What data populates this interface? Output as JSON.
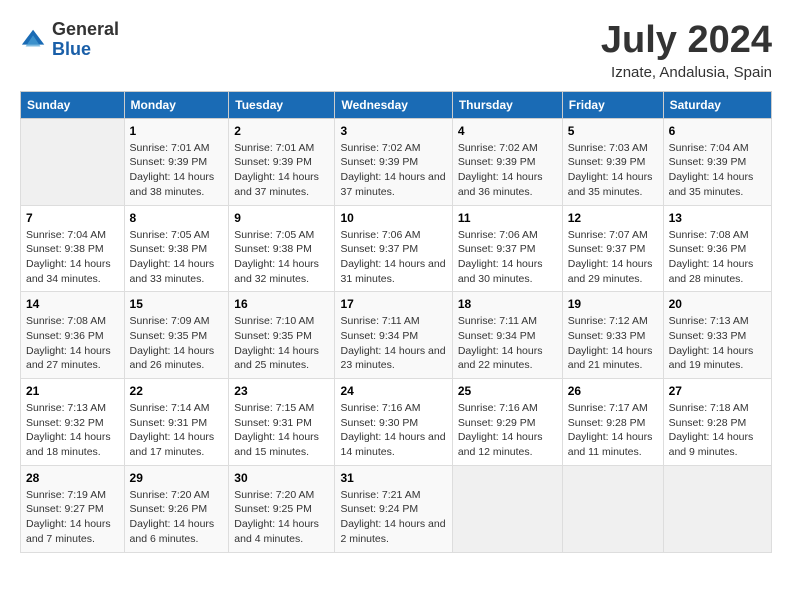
{
  "header": {
    "logo_line1": "General",
    "logo_line2": "Blue",
    "main_title": "July 2024",
    "subtitle": "Iznate, Andalusia, Spain"
  },
  "calendar": {
    "days_of_week": [
      "Sunday",
      "Monday",
      "Tuesday",
      "Wednesday",
      "Thursday",
      "Friday",
      "Saturday"
    ],
    "weeks": [
      [
        {
          "day": "",
          "sunrise": "",
          "sunset": "",
          "daylight": ""
        },
        {
          "day": "1",
          "sunrise": "Sunrise: 7:01 AM",
          "sunset": "Sunset: 9:39 PM",
          "daylight": "Daylight: 14 hours and 38 minutes."
        },
        {
          "day": "2",
          "sunrise": "Sunrise: 7:01 AM",
          "sunset": "Sunset: 9:39 PM",
          "daylight": "Daylight: 14 hours and 37 minutes."
        },
        {
          "day": "3",
          "sunrise": "Sunrise: 7:02 AM",
          "sunset": "Sunset: 9:39 PM",
          "daylight": "Daylight: 14 hours and 37 minutes."
        },
        {
          "day": "4",
          "sunrise": "Sunrise: 7:02 AM",
          "sunset": "Sunset: 9:39 PM",
          "daylight": "Daylight: 14 hours and 36 minutes."
        },
        {
          "day": "5",
          "sunrise": "Sunrise: 7:03 AM",
          "sunset": "Sunset: 9:39 PM",
          "daylight": "Daylight: 14 hours and 35 minutes."
        },
        {
          "day": "6",
          "sunrise": "Sunrise: 7:04 AM",
          "sunset": "Sunset: 9:39 PM",
          "daylight": "Daylight: 14 hours and 35 minutes."
        }
      ],
      [
        {
          "day": "7",
          "sunrise": "Sunrise: 7:04 AM",
          "sunset": "Sunset: 9:38 PM",
          "daylight": "Daylight: 14 hours and 34 minutes."
        },
        {
          "day": "8",
          "sunrise": "Sunrise: 7:05 AM",
          "sunset": "Sunset: 9:38 PM",
          "daylight": "Daylight: 14 hours and 33 minutes."
        },
        {
          "day": "9",
          "sunrise": "Sunrise: 7:05 AM",
          "sunset": "Sunset: 9:38 PM",
          "daylight": "Daylight: 14 hours and 32 minutes."
        },
        {
          "day": "10",
          "sunrise": "Sunrise: 7:06 AM",
          "sunset": "Sunset: 9:37 PM",
          "daylight": "Daylight: 14 hours and 31 minutes."
        },
        {
          "day": "11",
          "sunrise": "Sunrise: 7:06 AM",
          "sunset": "Sunset: 9:37 PM",
          "daylight": "Daylight: 14 hours and 30 minutes."
        },
        {
          "day": "12",
          "sunrise": "Sunrise: 7:07 AM",
          "sunset": "Sunset: 9:37 PM",
          "daylight": "Daylight: 14 hours and 29 minutes."
        },
        {
          "day": "13",
          "sunrise": "Sunrise: 7:08 AM",
          "sunset": "Sunset: 9:36 PM",
          "daylight": "Daylight: 14 hours and 28 minutes."
        }
      ],
      [
        {
          "day": "14",
          "sunrise": "Sunrise: 7:08 AM",
          "sunset": "Sunset: 9:36 PM",
          "daylight": "Daylight: 14 hours and 27 minutes."
        },
        {
          "day": "15",
          "sunrise": "Sunrise: 7:09 AM",
          "sunset": "Sunset: 9:35 PM",
          "daylight": "Daylight: 14 hours and 26 minutes."
        },
        {
          "day": "16",
          "sunrise": "Sunrise: 7:10 AM",
          "sunset": "Sunset: 9:35 PM",
          "daylight": "Daylight: 14 hours and 25 minutes."
        },
        {
          "day": "17",
          "sunrise": "Sunrise: 7:11 AM",
          "sunset": "Sunset: 9:34 PM",
          "daylight": "Daylight: 14 hours and 23 minutes."
        },
        {
          "day": "18",
          "sunrise": "Sunrise: 7:11 AM",
          "sunset": "Sunset: 9:34 PM",
          "daylight": "Daylight: 14 hours and 22 minutes."
        },
        {
          "day": "19",
          "sunrise": "Sunrise: 7:12 AM",
          "sunset": "Sunset: 9:33 PM",
          "daylight": "Daylight: 14 hours and 21 minutes."
        },
        {
          "day": "20",
          "sunrise": "Sunrise: 7:13 AM",
          "sunset": "Sunset: 9:33 PM",
          "daylight": "Daylight: 14 hours and 19 minutes."
        }
      ],
      [
        {
          "day": "21",
          "sunrise": "Sunrise: 7:13 AM",
          "sunset": "Sunset: 9:32 PM",
          "daylight": "Daylight: 14 hours and 18 minutes."
        },
        {
          "day": "22",
          "sunrise": "Sunrise: 7:14 AM",
          "sunset": "Sunset: 9:31 PM",
          "daylight": "Daylight: 14 hours and 17 minutes."
        },
        {
          "day": "23",
          "sunrise": "Sunrise: 7:15 AM",
          "sunset": "Sunset: 9:31 PM",
          "daylight": "Daylight: 14 hours and 15 minutes."
        },
        {
          "day": "24",
          "sunrise": "Sunrise: 7:16 AM",
          "sunset": "Sunset: 9:30 PM",
          "daylight": "Daylight: 14 hours and 14 minutes."
        },
        {
          "day": "25",
          "sunrise": "Sunrise: 7:16 AM",
          "sunset": "Sunset: 9:29 PM",
          "daylight": "Daylight: 14 hours and 12 minutes."
        },
        {
          "day": "26",
          "sunrise": "Sunrise: 7:17 AM",
          "sunset": "Sunset: 9:28 PM",
          "daylight": "Daylight: 14 hours and 11 minutes."
        },
        {
          "day": "27",
          "sunrise": "Sunrise: 7:18 AM",
          "sunset": "Sunset: 9:28 PM",
          "daylight": "Daylight: 14 hours and 9 minutes."
        }
      ],
      [
        {
          "day": "28",
          "sunrise": "Sunrise: 7:19 AM",
          "sunset": "Sunset: 9:27 PM",
          "daylight": "Daylight: 14 hours and 7 minutes."
        },
        {
          "day": "29",
          "sunrise": "Sunrise: 7:20 AM",
          "sunset": "Sunset: 9:26 PM",
          "daylight": "Daylight: 14 hours and 6 minutes."
        },
        {
          "day": "30",
          "sunrise": "Sunrise: 7:20 AM",
          "sunset": "Sunset: 9:25 PM",
          "daylight": "Daylight: 14 hours and 4 minutes."
        },
        {
          "day": "31",
          "sunrise": "Sunrise: 7:21 AM",
          "sunset": "Sunset: 9:24 PM",
          "daylight": "Daylight: 14 hours and 2 minutes."
        },
        {
          "day": "",
          "sunrise": "",
          "sunset": "",
          "daylight": ""
        },
        {
          "day": "",
          "sunrise": "",
          "sunset": "",
          "daylight": ""
        },
        {
          "day": "",
          "sunrise": "",
          "sunset": "",
          "daylight": ""
        }
      ]
    ]
  }
}
